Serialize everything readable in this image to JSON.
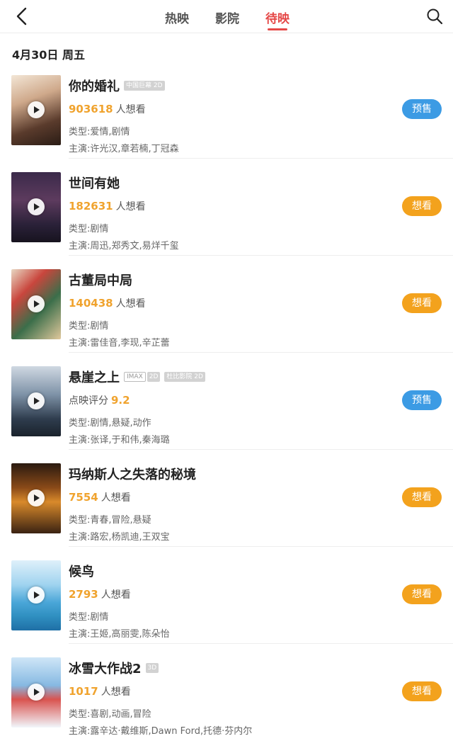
{
  "header": {
    "tabs": [
      {
        "label": "热映",
        "active": false
      },
      {
        "label": "影院",
        "active": false
      },
      {
        "label": "待映",
        "active": true
      }
    ],
    "accent_color": "#e54847"
  },
  "date_header": "4月30日 周五",
  "movies": [
    {
      "title": "你的婚礼",
      "tags": [
        "中国巨幕 2D"
      ],
      "stat_value": "903618",
      "stat_suffix": "人想看",
      "genre": "类型:爱情,剧情",
      "cast": "主演:许光汉,章若楠,丁冠森",
      "button": "预售",
      "button_color": "#3c9be4"
    },
    {
      "title": "世间有她",
      "tags": [],
      "stat_value": "182631",
      "stat_suffix": "人想看",
      "genre": "类型:剧情",
      "cast": "主演:周迅,郑秀文,易烊千玺",
      "button": "想看",
      "button_color": "#f3a21d"
    },
    {
      "title": "古董局中局",
      "tags": [],
      "stat_value": "140438",
      "stat_suffix": "人想看",
      "genre": "类型:剧情",
      "cast": "主演:雷佳音,李现,辛芷蕾",
      "button": "想看",
      "button_color": "#f3a21d"
    },
    {
      "title": "悬崖之上",
      "tags": [
        "IMAX",
        "2D",
        "杜比影院 2D"
      ],
      "stat_prefix": "点映评分",
      "stat_value": "9.2",
      "genre": "类型:剧情,悬疑,动作",
      "cast": "主演:张译,于和伟,秦海璐",
      "button": "预售",
      "button_color": "#3c9be4"
    },
    {
      "title": "玛纳斯人之失落的秘境",
      "tags": [],
      "stat_value": "7554",
      "stat_suffix": "人想看",
      "genre": "类型:青春,冒险,悬疑",
      "cast": "主演:路宏,杨凯迪,王双宝",
      "button": "想看",
      "button_color": "#f3a21d"
    },
    {
      "title": "候鸟",
      "tags": [],
      "stat_value": "2793",
      "stat_suffix": "人想看",
      "genre": "类型:剧情",
      "cast": "主演:王姬,高丽雯,陈朵怡",
      "button": "想看",
      "button_color": "#f3a21d"
    },
    {
      "title": "冰雪大作战2",
      "tags": [
        "3D"
      ],
      "stat_value": "1017",
      "stat_suffix": "人想看",
      "genre": "类型:喜剧,动画,冒险",
      "cast": "主演:露辛达·戴维斯,Dawn Ford,托德·芬内尔",
      "button": "想看",
      "button_color": "#f3a21d"
    }
  ]
}
